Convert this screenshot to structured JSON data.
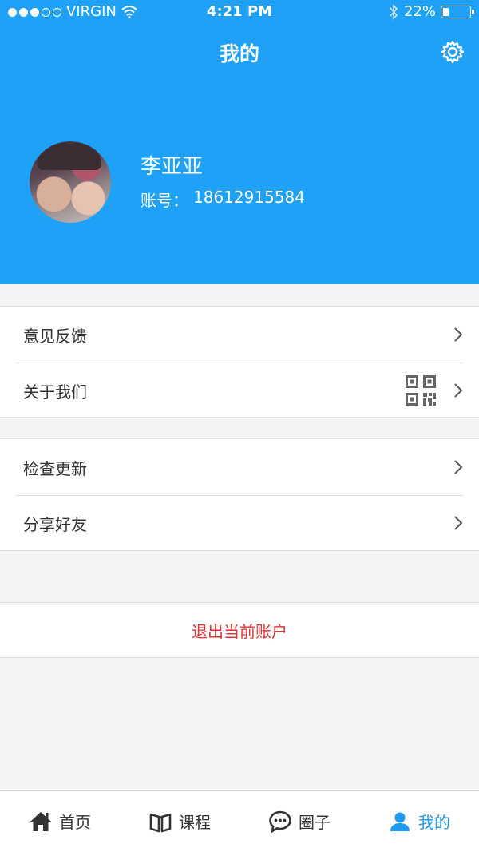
{
  "status_bar": {
    "carrier": "VIRGIN",
    "time": "4:21 PM",
    "battery": "22%",
    "battery_level": 0.22
  },
  "header": {
    "title": "我的",
    "settings_icon": "gear-icon"
  },
  "profile": {
    "name": "李亚亚",
    "account_label": "账号：",
    "account_value": "18612915584"
  },
  "menu_groups": [
    {
      "items": [
        {
          "label": "意见反馈",
          "icon": "chevron-right-icon"
        },
        {
          "label": "关于我们",
          "icon": "qr-code-icon"
        }
      ]
    },
    {
      "items": [
        {
          "label": "检查更新",
          "icon": "chevron-right-icon"
        },
        {
          "label": "分享好友",
          "icon": "chevron-right-icon"
        }
      ]
    }
  ],
  "logout_label": "退出当前账户",
  "tabs": [
    {
      "label": "首页",
      "icon": "home-icon",
      "active": false
    },
    {
      "label": "课程",
      "icon": "book-icon",
      "active": false
    },
    {
      "label": "圈子",
      "icon": "chat-bubble-icon",
      "active": false
    },
    {
      "label": "我的",
      "icon": "user-icon",
      "active": true
    }
  ],
  "colors": {
    "brand": "#1ea1f7",
    "active_tab": "#1e9af0",
    "logout": "#e2322f",
    "background": "#f4f4f4"
  }
}
